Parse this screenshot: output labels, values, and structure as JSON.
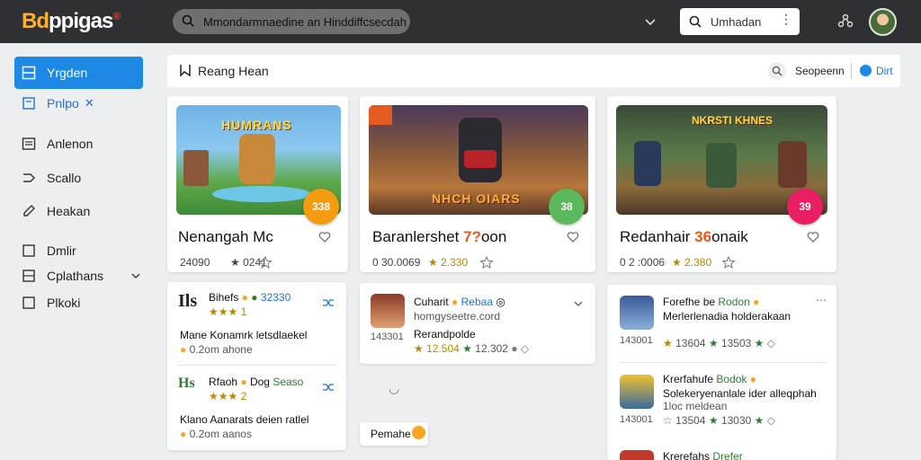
{
  "app": {
    "logo_part1": "Bd",
    "logo_part2": "ppigas",
    "logo_part3": "®"
  },
  "topbar": {
    "search_text": "Mmondarmnaedine an Hinddiffcsecdah",
    "secondary_search_text": "Umhadan",
    "secondary_menu": "⋮"
  },
  "sidebar": {
    "items": [
      {
        "label": "Yrgden",
        "icon": "window-icon"
      },
      {
        "label": "Pnlpo",
        "icon": "book-icon",
        "suffix": "✕"
      },
      {
        "label": "Anlenon",
        "icon": "list-icon"
      },
      {
        "label": "Scallo",
        "icon": "flow-icon"
      },
      {
        "label": "Heakan",
        "icon": "pencil-icon"
      },
      {
        "label": "Dmlir",
        "icon": "square-icon"
      },
      {
        "label": "Cplathans",
        "icon": "grid-icon"
      },
      {
        "label": "Plkoki",
        "icon": "checkbox-icon"
      }
    ]
  },
  "header": {
    "title": "Reang Hean",
    "search_label": "Seopeenn",
    "action_label": "Dirt"
  },
  "cards": [
    {
      "thumb_text": "HUMRANS",
      "badge": "338",
      "title": "Nenangah Mc",
      "title_hl": "",
      "title_suffix": "",
      "meta1": "24090",
      "meta2": "0241",
      "accent": "#f39c12"
    },
    {
      "thumb_text": "NHCH OIARS",
      "badge": "38",
      "title": "Baranlershet ",
      "title_hl": "7?",
      "title_suffix": "oon",
      "meta1": "0 30.0069",
      "meta2": "2.330",
      "accent": "#5cb85c"
    },
    {
      "thumb_text": "NKRSTI KHNES",
      "badge": "39",
      "title": "Redanhair ",
      "title_hl": "36",
      "title_suffix": "onaik",
      "meta1": "0 2 :0006",
      "meta2": "2.380",
      "accent": "#e91e63"
    }
  ],
  "left_list": {
    "head_logo": "Ils",
    "row1_name": "Bihefs",
    "row1_value": "32330",
    "row1_title": "Mane Konamrk letsdlaekel",
    "row1_sub": "0.2om ahone",
    "row2_logo": "Hs",
    "row2_name": "Rfaoh",
    "row2_tag": "Dog",
    "row2_value": "Seaso",
    "row2_title": "Klano Aanarats deien ratlel",
    "row2_sub": "0.2om aanos"
  },
  "middle_list": {
    "row_name": "Cuharit",
    "row_tag": "Rebaa",
    "row_url": "homgyseetre.cord",
    "row_label": "Rerandpolde",
    "views": "143301",
    "value1": "12.504",
    "value2": "12.302",
    "footer_text": "Pemahe"
  },
  "right_list": {
    "row1_name": "Forefhe be",
    "row1_tag": "Rodon",
    "row1_title": "Merlerlenadia holderakaan",
    "row1_views": "143001",
    "row1_value1": "13604",
    "row1_value2": "13503",
    "row2_name": "Krerfahufe",
    "row2_tag": "Bodok",
    "row2_title": "Solekeryenanlale ider alleqphah",
    "row2_sub": "1loc meldean",
    "row2_views": "143001",
    "row2_value1": "13504",
    "row2_value2": "13030",
    "row3_name": "Krerefahs",
    "row3_tag": "Drefer"
  }
}
